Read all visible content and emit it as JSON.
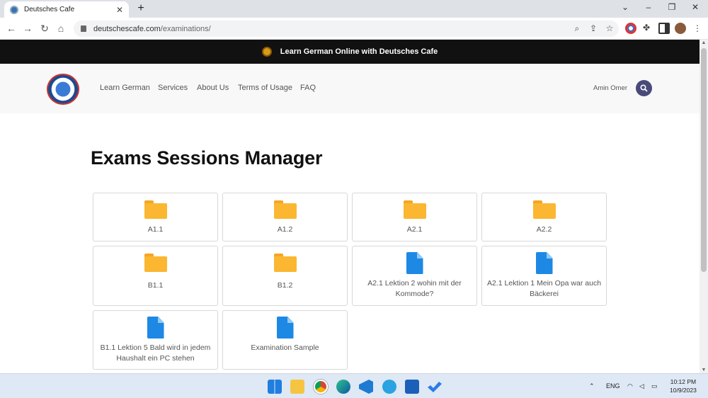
{
  "browser": {
    "tab_title": "Deutsches Cafe",
    "tab_close": "✕",
    "new_tab": "+",
    "url_domain": "deutschescafe.com",
    "url_path": "/examinations/"
  },
  "banner": {
    "text": "Learn German Online with Deutsches Cafe"
  },
  "nav": {
    "links": [
      "Learn German",
      "Services",
      "About Us",
      "Terms of Usage",
      "FAQ"
    ],
    "user_name": "Amin Omer"
  },
  "main": {
    "title": "Exams Sessions Manager",
    "items": [
      {
        "type": "folder",
        "label": "A1.1"
      },
      {
        "type": "folder",
        "label": "A1.2"
      },
      {
        "type": "folder",
        "label": "A2.1"
      },
      {
        "type": "folder",
        "label": "A2.2"
      },
      {
        "type": "folder",
        "label": "B1.1"
      },
      {
        "type": "folder",
        "label": "B1.2"
      },
      {
        "type": "file",
        "label": "A2.1 Lektion 2 wohin mit der Kommode?"
      },
      {
        "type": "file",
        "label": "A2.1 Lektion 1 Mein Opa war auch Bäckerei"
      },
      {
        "type": "file",
        "label": "B1.1 Lektion 5 Bald wird in jedem Haushalt ein PC stehen"
      },
      {
        "type": "file",
        "label": "Examination Sample"
      }
    ]
  },
  "taskbar": {
    "language": "ENG",
    "time": "10:12 PM",
    "date": "10/9/2023"
  },
  "colors": {
    "folder": "#fbb731",
    "file": "#1e88e5",
    "banner_bg": "#111111",
    "search_button": "#4a4a7a"
  }
}
